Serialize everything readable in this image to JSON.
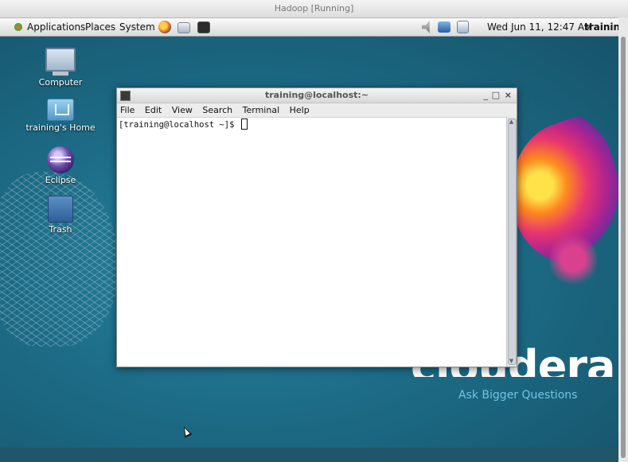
{
  "vm": {
    "title": "Hadoop [Running]"
  },
  "panel": {
    "applications": "Applications",
    "places": "Places",
    "system": "System",
    "datetime": "Wed Jun 11, 12:47 AM",
    "user": "trainin"
  },
  "desktop": {
    "icons": [
      {
        "label": "Computer"
      },
      {
        "label": "training's Home"
      },
      {
        "label": "Eclipse"
      },
      {
        "label": "Trash"
      }
    ],
    "logo": "cloudera",
    "tagline": "Ask Bigger Questions"
  },
  "terminal": {
    "title": "training@localhost:~",
    "minimize": "_",
    "maximize": "□",
    "close": "×",
    "menu": [
      "File",
      "Edit",
      "View",
      "Search",
      "Terminal",
      "Help"
    ],
    "prompt": "[training@localhost ~]$ "
  },
  "colors": {
    "desktop": "#1d6c87",
    "tagline": "#6fc4e6"
  }
}
